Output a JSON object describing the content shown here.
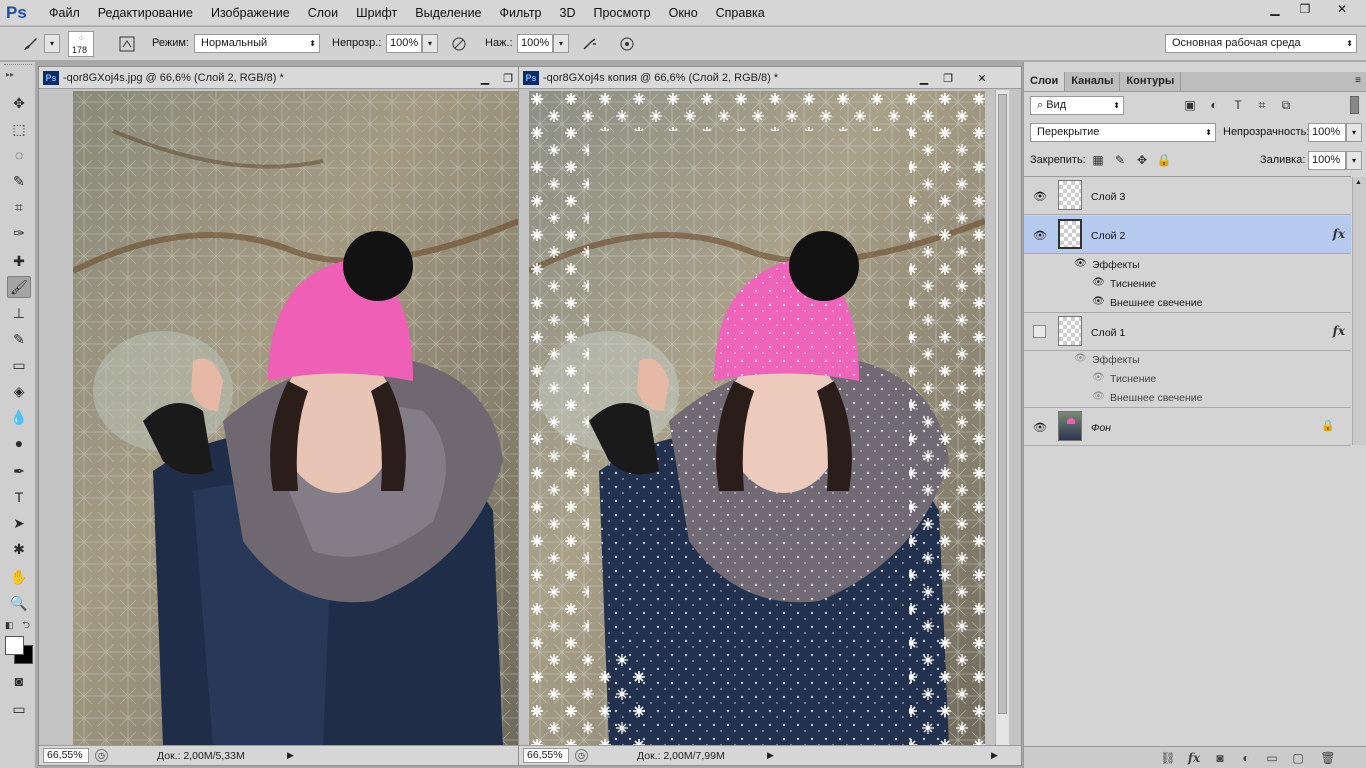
{
  "app": {
    "logo": "Ps"
  },
  "menu": [
    "Файл",
    "Редактирование",
    "Изображение",
    "Слои",
    "Шрифт",
    "Выделение",
    "Фильтр",
    "3D",
    "Просмотр",
    "Окно",
    "Справка"
  ],
  "window_controls": {
    "minimize": "▁",
    "restore": "❐",
    "close": "✕"
  },
  "options": {
    "brush_size": "178",
    "mode_label": "Режим:",
    "mode_value": "Нормальный",
    "opacity_label": "Непрозр.:",
    "opacity_value": "100%",
    "pressure_label": "Наж.:",
    "pressure_value": "100%",
    "workspace": "Основная рабочая среда"
  },
  "tools": [
    "move-icon",
    "marquee-icon",
    "lasso-icon",
    "quick-select-icon",
    "crop-icon",
    "eyedropper-icon",
    "healing-icon",
    "brush-icon",
    "stamp-icon",
    "history-brush-icon",
    "eraser-icon",
    "paint-bucket-icon",
    "blur-icon",
    "dodge-icon",
    "pen-icon",
    "type-icon",
    "path-select-icon",
    "shape-icon",
    "hand-icon",
    "zoom-icon"
  ],
  "tool_glyphs": [
    "✥",
    "⬚",
    "◌",
    "✎",
    "⌗",
    "✑",
    "✚",
    "🖌",
    "⊥",
    "✎",
    "▭",
    "◈",
    "💧",
    "●",
    "✒",
    "T",
    "➤",
    "✱",
    "✋",
    "🔍"
  ],
  "doc1": {
    "title": "-qor8GXoj4s.jpg @ 66,6% (Слой 2, RGB/8) *",
    "zoom": "66,55%",
    "doc_size": "Док.: 2,00M/5,33M"
  },
  "doc2": {
    "title": "-qor8GXoj4s копия @ 66,6% (Слой 2, RGB/8) *",
    "zoom": "66,55%",
    "doc_size": "Док.: 2,00M/7,99M"
  },
  "layers_panel": {
    "tabs": [
      "Слои",
      "Каналы",
      "Контуры"
    ],
    "filter_value": "Вид",
    "blend_mode": "Перекрытие",
    "opacity_label": "Непрозрачность:",
    "opacity_value": "100%",
    "lock_label": "Закрепить:",
    "fill_label": "Заливка:",
    "fill_value": "100%",
    "layers": [
      {
        "name": "Слой 3"
      },
      {
        "name": "Слой 2",
        "fx": "fx",
        "effects_label": "Эффекты",
        "effects": [
          "Тиснение",
          "Внешнее свечение"
        ]
      },
      {
        "name": "Слой 1",
        "fx": "fx",
        "effects_label": "Эффекты",
        "effects": [
          "Тиснение",
          "Внешнее свечение"
        ]
      },
      {
        "name": "Фон"
      }
    ]
  }
}
